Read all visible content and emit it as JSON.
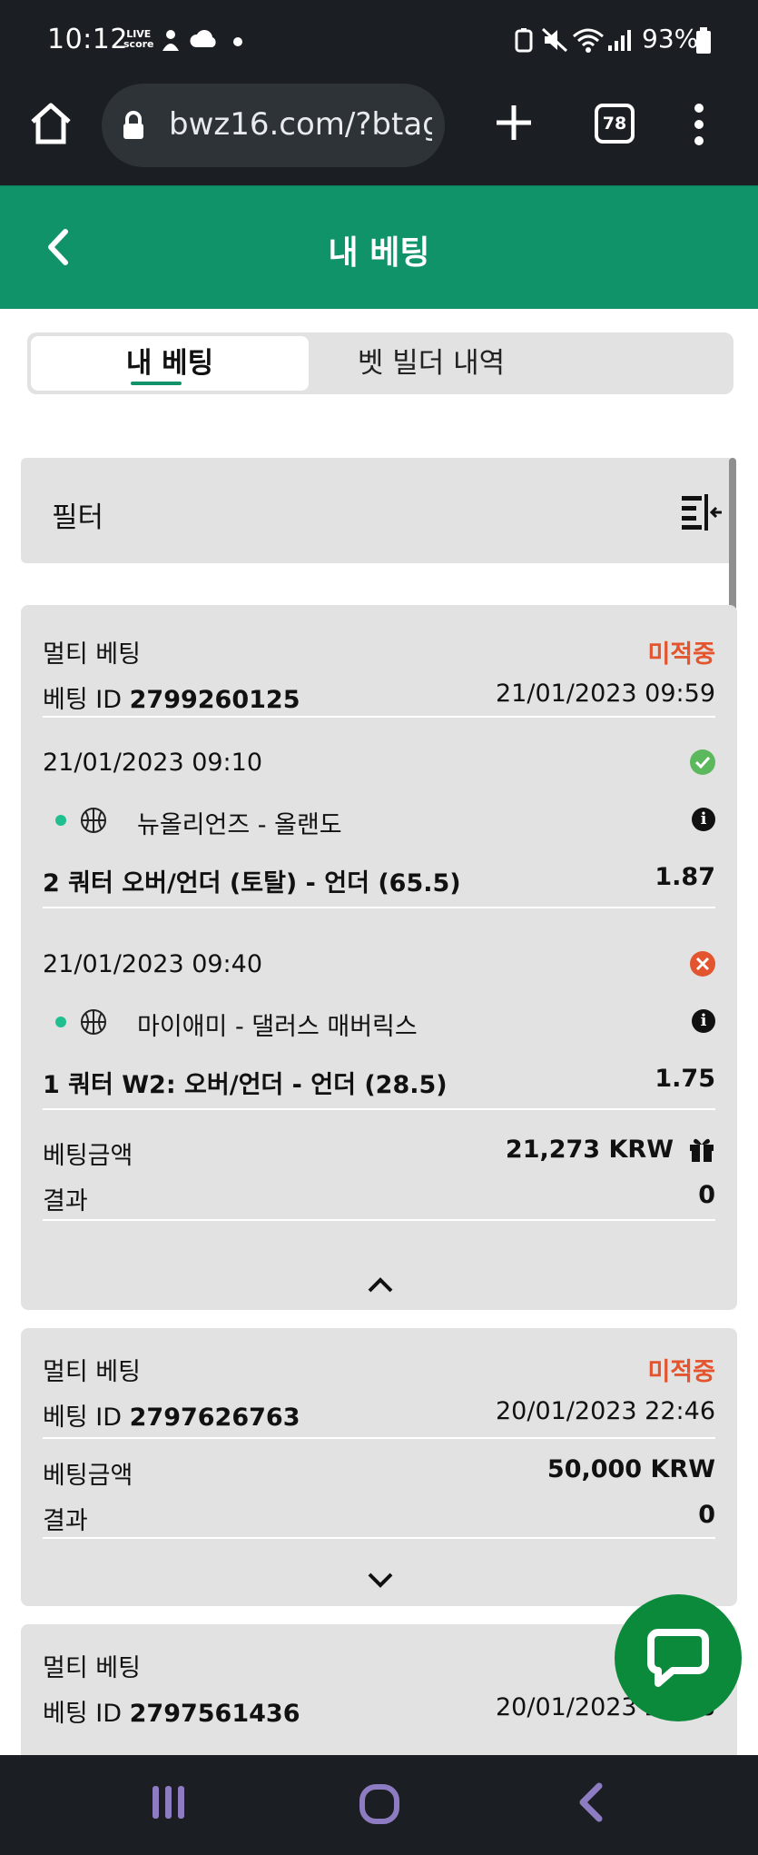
{
  "status_bar": {
    "time": "10:12",
    "live_top": "LIVE",
    "live_bottom": "score",
    "battery": "93%"
  },
  "browser": {
    "url": "bwz16.com/?btag",
    "tab_count": "78"
  },
  "header": {
    "title": "내 베팅"
  },
  "tabs": [
    {
      "label": "내 베팅",
      "active": true
    },
    {
      "label": "벳 빌더 내역",
      "active": false
    }
  ],
  "filter": {
    "label": "필터"
  },
  "bets": [
    {
      "type": "멀티 베팅",
      "status": "미적중",
      "id_label": "베팅 ID",
      "id": "2799260125",
      "datetime": "21/01/2023 09:59",
      "selections": [
        {
          "datetime": "21/01/2023 09:10",
          "result": "won",
          "match": "뉴올리언즈 - 올랜도",
          "market": "2 쿼터 오버/언더 (토탈) - 언더 (65.5)",
          "odds": "1.87"
        },
        {
          "datetime": "21/01/2023 09:40",
          "result": "lost",
          "match": "마이애미 - 댈러스 매버릭스",
          "market": "1 쿼터 W2: 오버/언더 - 언더 (28.5)",
          "odds": "1.75"
        }
      ],
      "stake_label": "베팅금액",
      "stake": "21,273 KRW",
      "result_label": "결과",
      "result": "0"
    },
    {
      "type": "멀티 베팅",
      "status": "미적중",
      "id_label": "베팅 ID",
      "id": "2797626763",
      "datetime": "20/01/2023 22:46",
      "stake_label": "베팅금액",
      "stake": "50,000 KRW",
      "result_label": "결과",
      "result": "0"
    },
    {
      "type": "멀티 베팅",
      "id_label": "베팅 ID",
      "id": "2797561436",
      "datetime": "20/01/2023 22:18"
    }
  ],
  "colors": {
    "brand_green": "#11936a",
    "lost_red": "#e3552e",
    "won_green": "#5cb85c",
    "chat_green": "#0c8a3b"
  }
}
